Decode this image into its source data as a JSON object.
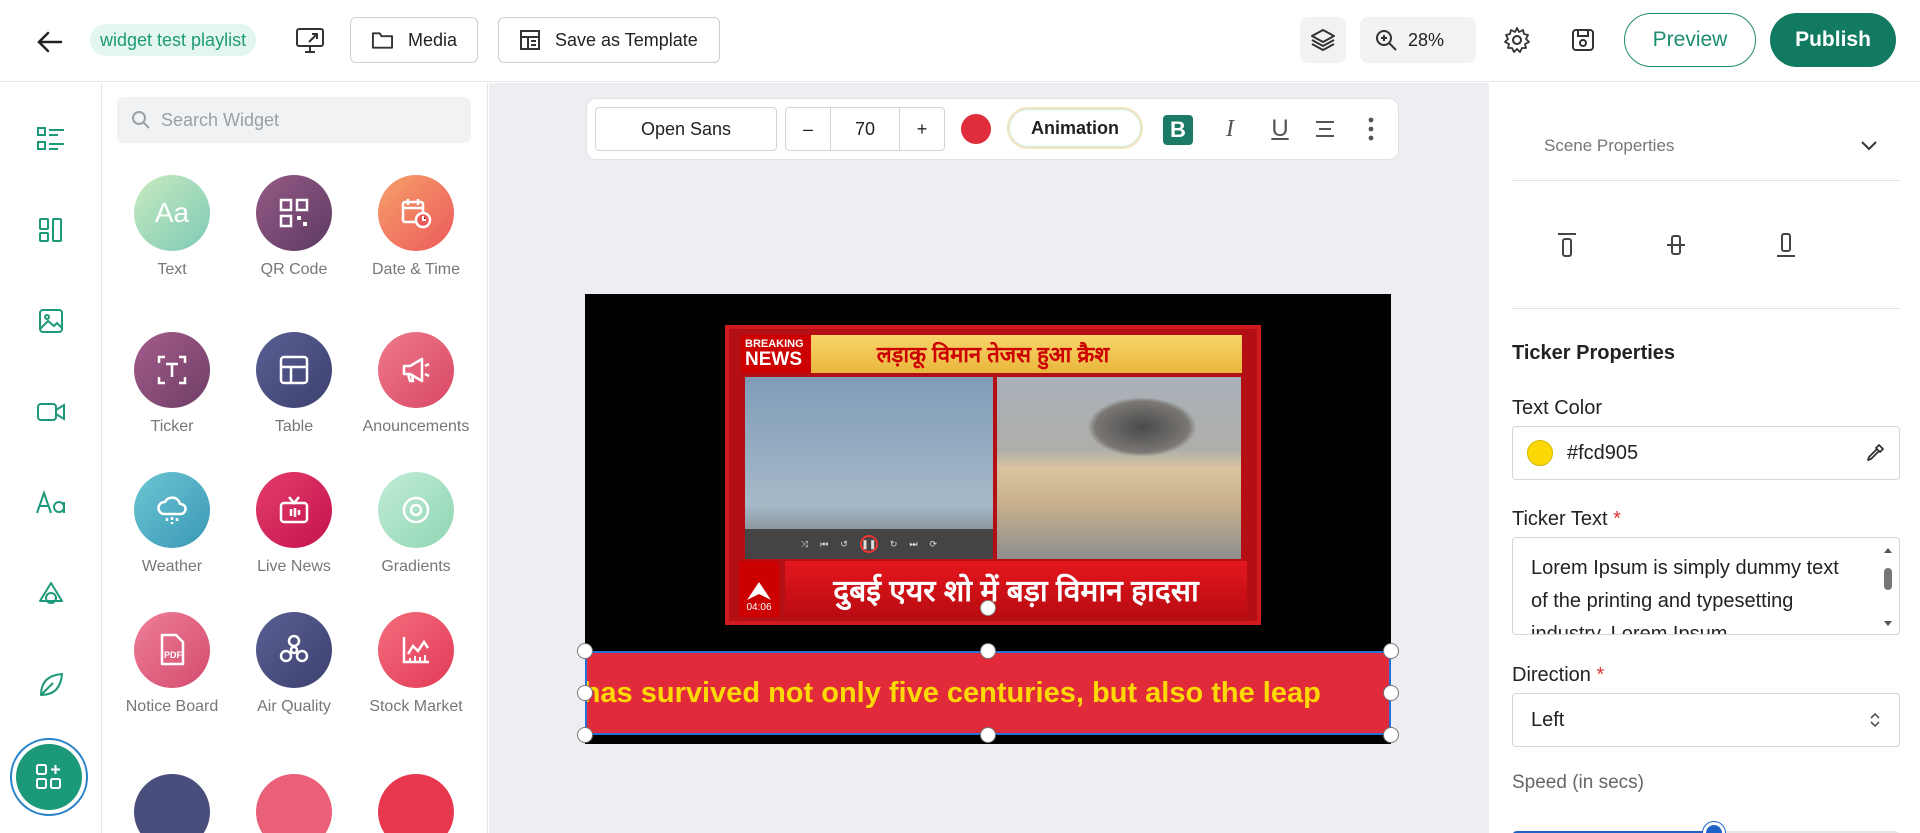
{
  "header": {
    "playlist_name": "widget test playlist",
    "media_label": "Media",
    "save_template_label": "Save as Template",
    "zoom": "28%",
    "preview_label": "Preview",
    "publish_label": "Publish"
  },
  "widget_panel": {
    "search_placeholder": "Search Widget",
    "widgets": [
      {
        "label": "Text",
        "color": "#a6d8a8"
      },
      {
        "label": "QR Code",
        "color": "#7a4c74"
      },
      {
        "label": "Date & Time",
        "color": "#f27d5e"
      },
      {
        "label": "Ticker",
        "color": "#8a4f78"
      },
      {
        "label": "Table",
        "color": "#4a4e7d"
      },
      {
        "label": "Anouncements",
        "color": "#e26179"
      },
      {
        "label": "Weather",
        "color": "#4fb4c8"
      },
      {
        "label": "Live News",
        "color": "#d8285c"
      },
      {
        "label": "Gradients",
        "color": "#9fe0c2"
      },
      {
        "label": "Notice Board",
        "color": "#e45a7b"
      },
      {
        "label": "Air Quality",
        "color": "#4a4e7d"
      },
      {
        "label": "Stock Market",
        "color": "#f0506a"
      }
    ]
  },
  "toolbar": {
    "font": "Open Sans",
    "size": "70",
    "minus": "–",
    "plus": "+",
    "animation_label": "Animation",
    "bold": "B",
    "italic": "I",
    "underline": "U",
    "text_color": "#e02d3c"
  },
  "stage": {
    "breaking_line1": "BREAKING",
    "breaking_line2": "NEWS",
    "headline_top": "लड़ाकू विमान तेजस हुआ क्रैश",
    "headline_bottom": "दुबई एयर शो में बड़ा विमान हादसा",
    "clock": "04:06",
    "ticker_visible_text": "t has survived not only five centuries, but also the leap"
  },
  "properties": {
    "scene_properties": "Scene Properties",
    "ticker_properties": "Ticker Properties",
    "text_color_label": "Text Color",
    "text_color_value": "#fcd905",
    "ticker_text_label": "Ticker Text",
    "ticker_text_value": "Lorem Ipsum is simply dummy text of the printing and typesetting industry. Lorem Ipsum",
    "direction_label": "Direction",
    "direction_value": "Left",
    "speed_label": "Speed (in secs)",
    "required_mark": "*",
    "speed_fraction": 0.52
  }
}
